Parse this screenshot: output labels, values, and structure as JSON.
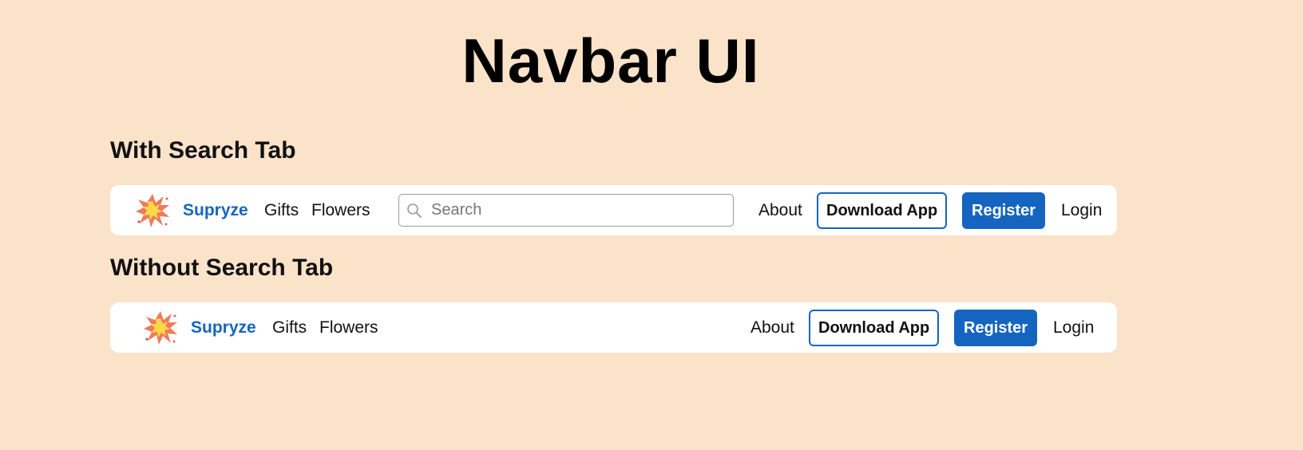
{
  "page": {
    "title": "Navbar UI"
  },
  "sections": [
    {
      "heading": "With Search Tab",
      "navbar": {
        "logo_icon": "burst-logo-icon",
        "brand": "Supryze",
        "links": [
          "Gifts",
          "Flowers"
        ],
        "search": {
          "placeholder": "Search",
          "value": "",
          "icon": "search-icon"
        },
        "about": "About",
        "download_button": "Download App",
        "register_button": "Register",
        "login": "Login"
      }
    },
    {
      "heading": "Without Search Tab",
      "navbar": {
        "logo_icon": "burst-logo-icon",
        "brand": "Supryze",
        "links": [
          "Gifts",
          "Flowers"
        ],
        "about": "About",
        "download_button": "Download App",
        "register_button": "Register",
        "login": "Login"
      }
    }
  ],
  "colors": {
    "background": "#fbe3ca",
    "navbar_bg": "#ffffff",
    "accent": "#1565c0",
    "logo_outer": "#f07a5a",
    "logo_inner": "#ffd84a"
  }
}
